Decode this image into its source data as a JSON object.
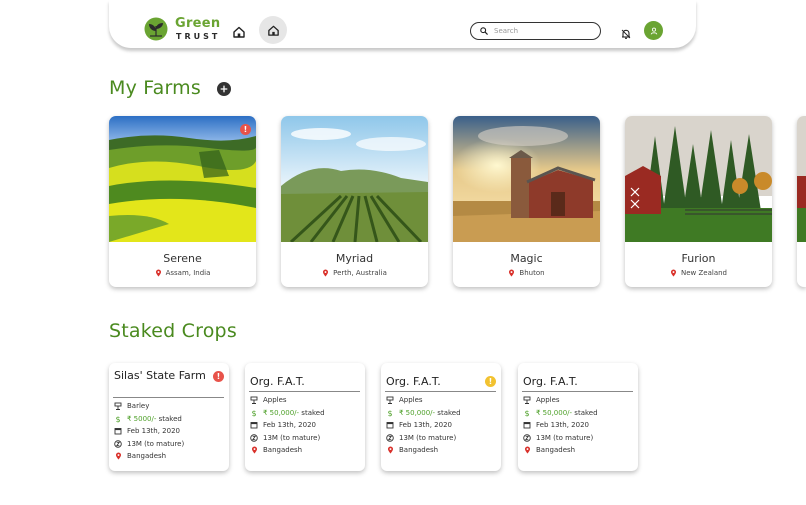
{
  "header": {
    "brand_top": "Green",
    "brand_bottom": "TRUST",
    "search_placeholder": "Search"
  },
  "farms_section": {
    "title": "My Farms",
    "farms": [
      {
        "name": "Serene",
        "location": "Assam, India",
        "alert": "!",
        "alert_color": "#e8534a"
      },
      {
        "name": "Myriad",
        "location": "Perth, Australia"
      },
      {
        "name": "Magic",
        "location": "Bhuton"
      },
      {
        "name": "Furion",
        "location": "New Zealand"
      }
    ]
  },
  "crops_section": {
    "title": "Staked Crops",
    "crops": [
      {
        "title": "Silas' State Farm",
        "crop": "Barley",
        "stake": "₹ 5000/-",
        "stake_suffix": "staked",
        "date": "Feb 13th, 2020",
        "maturity": "13M (to mature)",
        "location": "Bangadesh",
        "alert": "!",
        "alert_color": "#e8534a"
      },
      {
        "title": "Org. F.A.T.",
        "crop": "Apples",
        "stake": "₹ 50,000/-",
        "stake_suffix": "staked",
        "date": "Feb 13th, 2020",
        "maturity": "13M (to mature)",
        "location": "Bangadesh"
      },
      {
        "title": "Org. F.A.T.",
        "crop": "Apples",
        "stake": "₹ 50,000/-",
        "stake_suffix": "staked",
        "date": "Feb 13th, 2020",
        "maturity": "13M (to mature)",
        "location": "Bangadesh",
        "alert": "!",
        "alert_color": "#f2c230"
      },
      {
        "title": "Org. F.A.T.",
        "crop": "Apples",
        "stake": "₹ 50,000/-",
        "stake_suffix": "staked",
        "date": "Feb 13th, 2020",
        "maturity": "13M (to mature)",
        "location": "Bangadesh"
      }
    ]
  },
  "colors": {
    "brand_green": "#6aa432",
    "title_green": "#4a8a1f",
    "stake_green": "#4fa12a",
    "alert_red": "#e8534a",
    "alert_yellow": "#f2c230"
  }
}
